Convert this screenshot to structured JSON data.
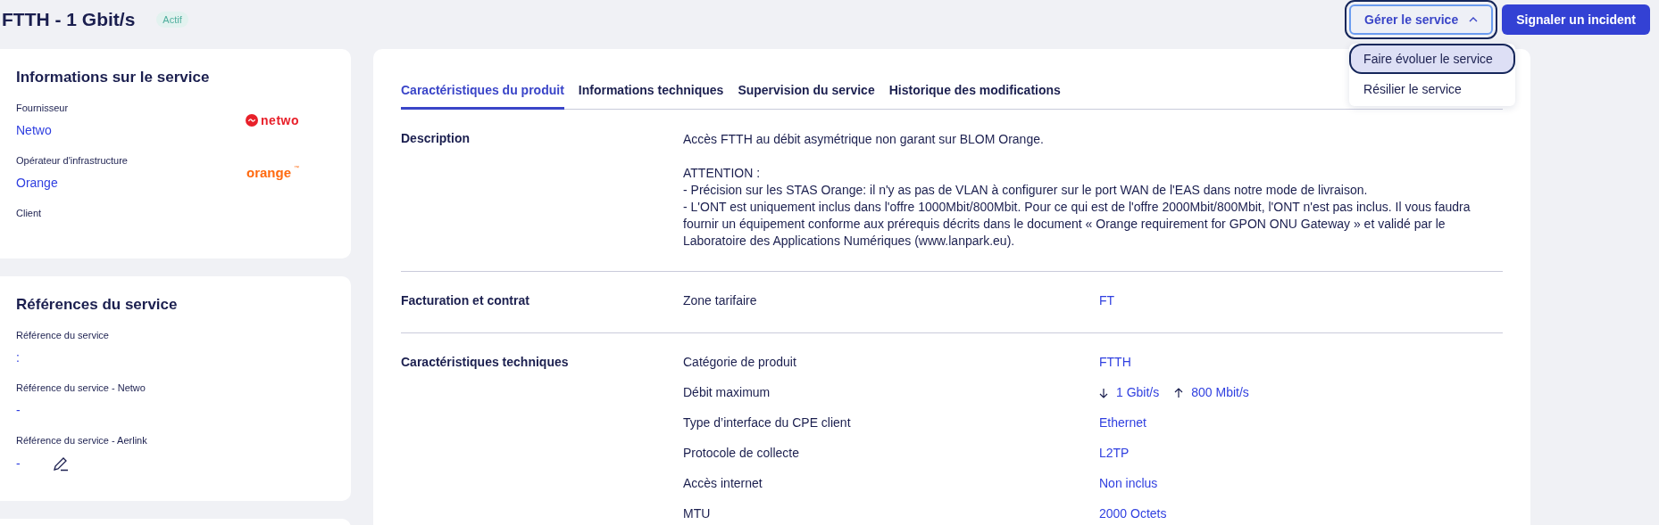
{
  "header": {
    "title": "FTTH - 1 Gbit/s",
    "status": "Actif"
  },
  "actions": {
    "manage": {
      "label": "Gérer le service",
      "expanded": true
    },
    "menu": [
      {
        "label": "Faire évoluer le service",
        "selected": true
      },
      {
        "label": "Résilier le service",
        "selected": false
      }
    ],
    "report": "Signaler un incident"
  },
  "service_info": {
    "title": "Informations sur le service",
    "fields": [
      {
        "label": "Fournisseur",
        "value": "Netwo",
        "logo": {
          "kind": "netwo",
          "text": "netwo"
        }
      },
      {
        "label": "Opérateur d'infrastructure",
        "value": "Orange",
        "logo": {
          "kind": "orange",
          "text": "orange",
          "mark": "™"
        }
      },
      {
        "label": "Client"
      }
    ]
  },
  "references": {
    "title": "Références du service",
    "fields": [
      {
        "label": "Référence du service",
        "value": ":",
        "editable": false
      },
      {
        "label": "Référence du service - Netwo",
        "value": "-",
        "editable": false
      },
      {
        "label": "Référence du service - Aerlink",
        "value": "-",
        "editable": true
      }
    ]
  },
  "tabs": [
    {
      "label": "Caractéristiques du produit",
      "selected": true
    },
    {
      "label": "Informations techniques",
      "selected": false
    },
    {
      "label": "Supervision du service",
      "selected": false
    },
    {
      "label": "Historique des modifications",
      "selected": false
    }
  ],
  "sections": [
    {
      "title": "Description",
      "rows": [
        {
          "kind": "text",
          "value": "Accès FTTH au débit asymétrique non garant sur BLOM Orange.\n\nATTENTION :\n- Précision sur les STAS Orange: il n'y as pas de VLAN à configurer sur le port WAN de l'EAS dans notre mode de livraison.\n- L'ONT est uniquement inclus dans l'offre 1000Mbit/800Mbit. Pour ce qui est de l'offre 2000Mbit/800Mbit, l'ONT n'est pas inclus. Il vous faudra fournir un équipement conforme aux prérequis décrits dans le document « Orange requirement for GPON ONU Gateway » et validé par le Laboratoire des Applications Numériques (www.lanpark.eu)."
        }
      ]
    },
    {
      "title": "Facturation et contrat",
      "rows": [
        {
          "kind": "field",
          "label": "Zone tarifaire",
          "value": "FT"
        }
      ]
    },
    {
      "title": "Caractéristiques techniques",
      "rows": [
        {
          "kind": "field",
          "label": "Catégorie de produit",
          "value": "FTTH"
        },
        {
          "kind": "rates",
          "label": "Débit maximum",
          "down": "1 Gbit/s",
          "up": "800 Mbit/s"
        },
        {
          "kind": "field",
          "label": "Type d’interface du CPE client",
          "value": "Ethernet"
        },
        {
          "kind": "field",
          "label": "Protocole de collecte",
          "value": "L2TP"
        },
        {
          "kind": "field",
          "label": "Accès internet",
          "value": "Non inclus"
        },
        {
          "kind": "field",
          "label": "MTU",
          "value": "2000 Octets"
        }
      ]
    }
  ]
}
